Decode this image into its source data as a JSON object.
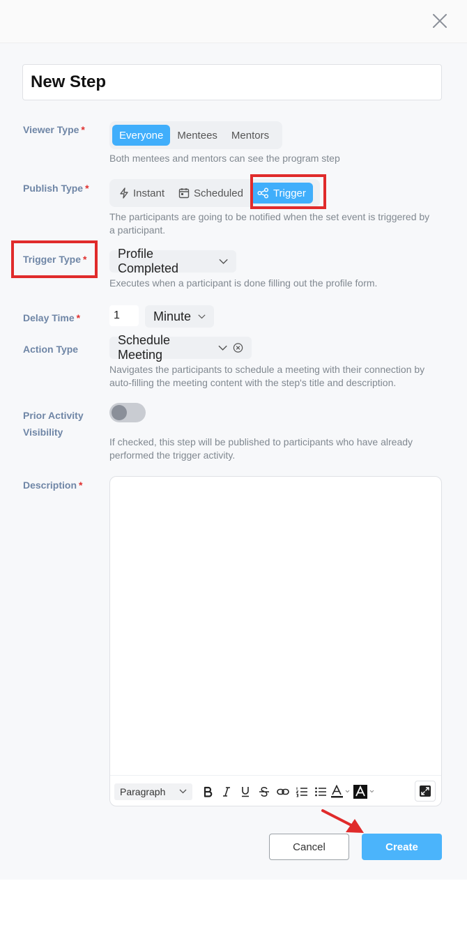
{
  "title": "New Step",
  "required_mark": "*",
  "viewer_type": {
    "label": "Viewer Type",
    "options": [
      "Everyone",
      "Mentees",
      "Mentors"
    ],
    "selected": "Everyone",
    "help": "Both mentees and mentors can see the program step"
  },
  "publish_type": {
    "label": "Publish Type",
    "options": [
      "Instant",
      "Scheduled",
      "Trigger"
    ],
    "selected": "Trigger",
    "help": "The participants are going to be notified when the set event is triggered by a participant."
  },
  "trigger_type": {
    "label": "Trigger Type",
    "value": "Profile Completed",
    "help": "Executes when a participant is done filling out the profile form."
  },
  "delay_time": {
    "label": "Delay Time",
    "value": "1",
    "unit": "Minute"
  },
  "action_type": {
    "label": "Action Type",
    "value": "Schedule Meeting",
    "help": "Navigates the participants to schedule a meeting with their connection by auto-filling the meeting content with the step's title and description."
  },
  "prior_activity": {
    "label_line1": "Prior Activity",
    "label_line2": "Visibility",
    "checked": false,
    "help": "If checked, this step will be published to participants who have already performed the trigger activity."
  },
  "description": {
    "label": "Description",
    "format": "Paragraph"
  },
  "icons": {
    "close": "close-icon",
    "instant": "bolt-icon",
    "scheduled": "calendar-icon",
    "trigger": "share-nodes-icon",
    "chevron": "chevron-down-icon",
    "clear": "clear-circle-icon",
    "expand": "expand-icon"
  },
  "colors": {
    "accent": "#40aefb",
    "highlight": "#e02b2b",
    "label": "#6f86a6"
  },
  "buttons": {
    "cancel": "Cancel",
    "create": "Create"
  }
}
